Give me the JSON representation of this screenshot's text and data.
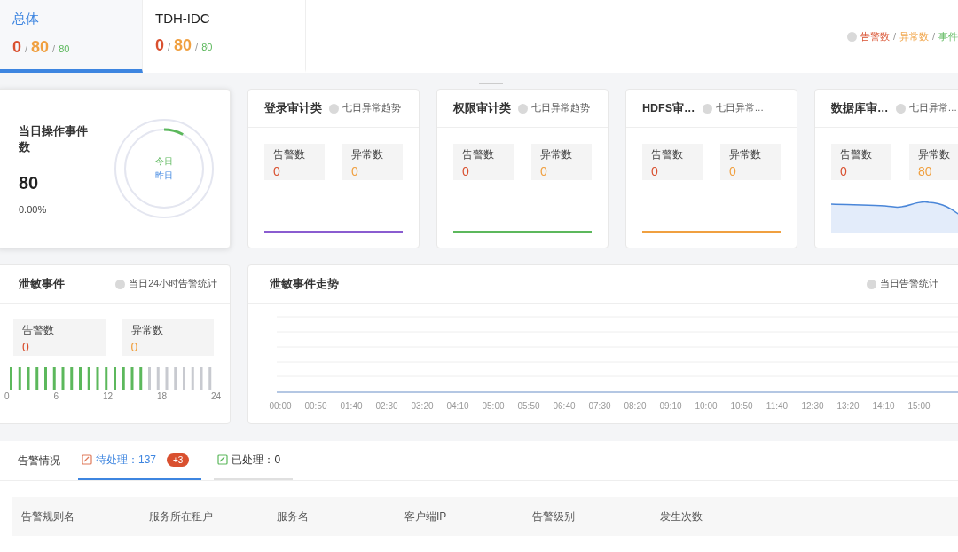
{
  "tenant_tabs": [
    {
      "name": "总体",
      "alarms": "0",
      "anomalies": "80",
      "events": "80",
      "selected": true
    },
    {
      "name": "TDH-IDC",
      "alarms": "0",
      "anomalies": "80",
      "events": "80",
      "selected": false
    }
  ],
  "separator": "/",
  "legend": {
    "alarms": "告警数",
    "anomalies": "异常数",
    "events": "事件"
  },
  "daily_card": {
    "title": "当日操作事件数",
    "count": "80",
    "percent": "0.00%",
    "today": "今日",
    "yesterday": "昨日",
    "level": 0.08
  },
  "audit_cards": [
    {
      "title": "登录审计类",
      "hint": "七日异常趋势",
      "alarm_label": "告警数",
      "alarm": "0",
      "anomaly_label": "异常数",
      "anomaly": "0",
      "kind": "flat",
      "color": "#8a5cd0"
    },
    {
      "title": "权限审计类",
      "hint": "七日异常趋势",
      "alarm_label": "告警数",
      "alarm": "0",
      "anomaly_label": "异常数",
      "anomaly": "0",
      "kind": "flat",
      "color": "#5cb85c"
    },
    {
      "title": "HDFS审…",
      "hint": "七日异常…",
      "alarm_label": "告警数",
      "alarm": "0",
      "anomaly_label": "异常数",
      "anomaly": "0",
      "kind": "flat",
      "color": "#f0a040"
    },
    {
      "title": "数据库审…",
      "hint": "七日异常…",
      "alarm_label": "告警数",
      "alarm": "0",
      "anomaly_label": "异常数",
      "anomaly": "80",
      "kind": "area",
      "color": "#4a86d8"
    }
  ],
  "leak_card": {
    "title": "泄敏事件",
    "hint": "当日24小时告警统计",
    "alarm_label": "告警数",
    "alarm": "0",
    "anomaly_label": "异常数",
    "anomaly": "0",
    "bars": [
      {
        "active": true
      },
      {
        "active": true
      },
      {
        "active": true
      },
      {
        "active": true
      },
      {
        "active": true
      },
      {
        "active": true
      },
      {
        "active": true
      },
      {
        "active": true
      },
      {
        "active": true
      },
      {
        "active": true
      },
      {
        "active": true
      },
      {
        "active": true
      },
      {
        "active": true
      },
      {
        "active": true
      },
      {
        "active": true
      },
      {
        "active": true
      },
      {
        "active": false
      },
      {
        "active": false
      },
      {
        "active": false
      },
      {
        "active": false
      },
      {
        "active": false
      },
      {
        "active": false
      },
      {
        "active": false
      },
      {
        "active": false
      }
    ],
    "ticks": [
      "0",
      "6",
      "12",
      "18",
      "24"
    ]
  },
  "trend_card": {
    "title": "泄敏事件走势",
    "hint": "当日告警统计",
    "x_labels": [
      "00:00",
      "00:50",
      "01:40",
      "02:30",
      "03:20",
      "04:10",
      "05:00",
      "05:50",
      "06:40",
      "07:30",
      "08:20",
      "09:10",
      "10:00",
      "10:50",
      "11:40",
      "12:30",
      "13:20",
      "14:10",
      "15:00"
    ]
  },
  "alerts": {
    "title": "告警情况",
    "tabs": [
      {
        "label": "待处理：137",
        "badge": "+3",
        "selected": true
      },
      {
        "label": "已处理：0",
        "selected": false
      }
    ],
    "columns": [
      "告警规则名",
      "服务所在租户",
      "服务名",
      "客户端IP",
      "告警级别",
      "发生次数"
    ]
  }
}
